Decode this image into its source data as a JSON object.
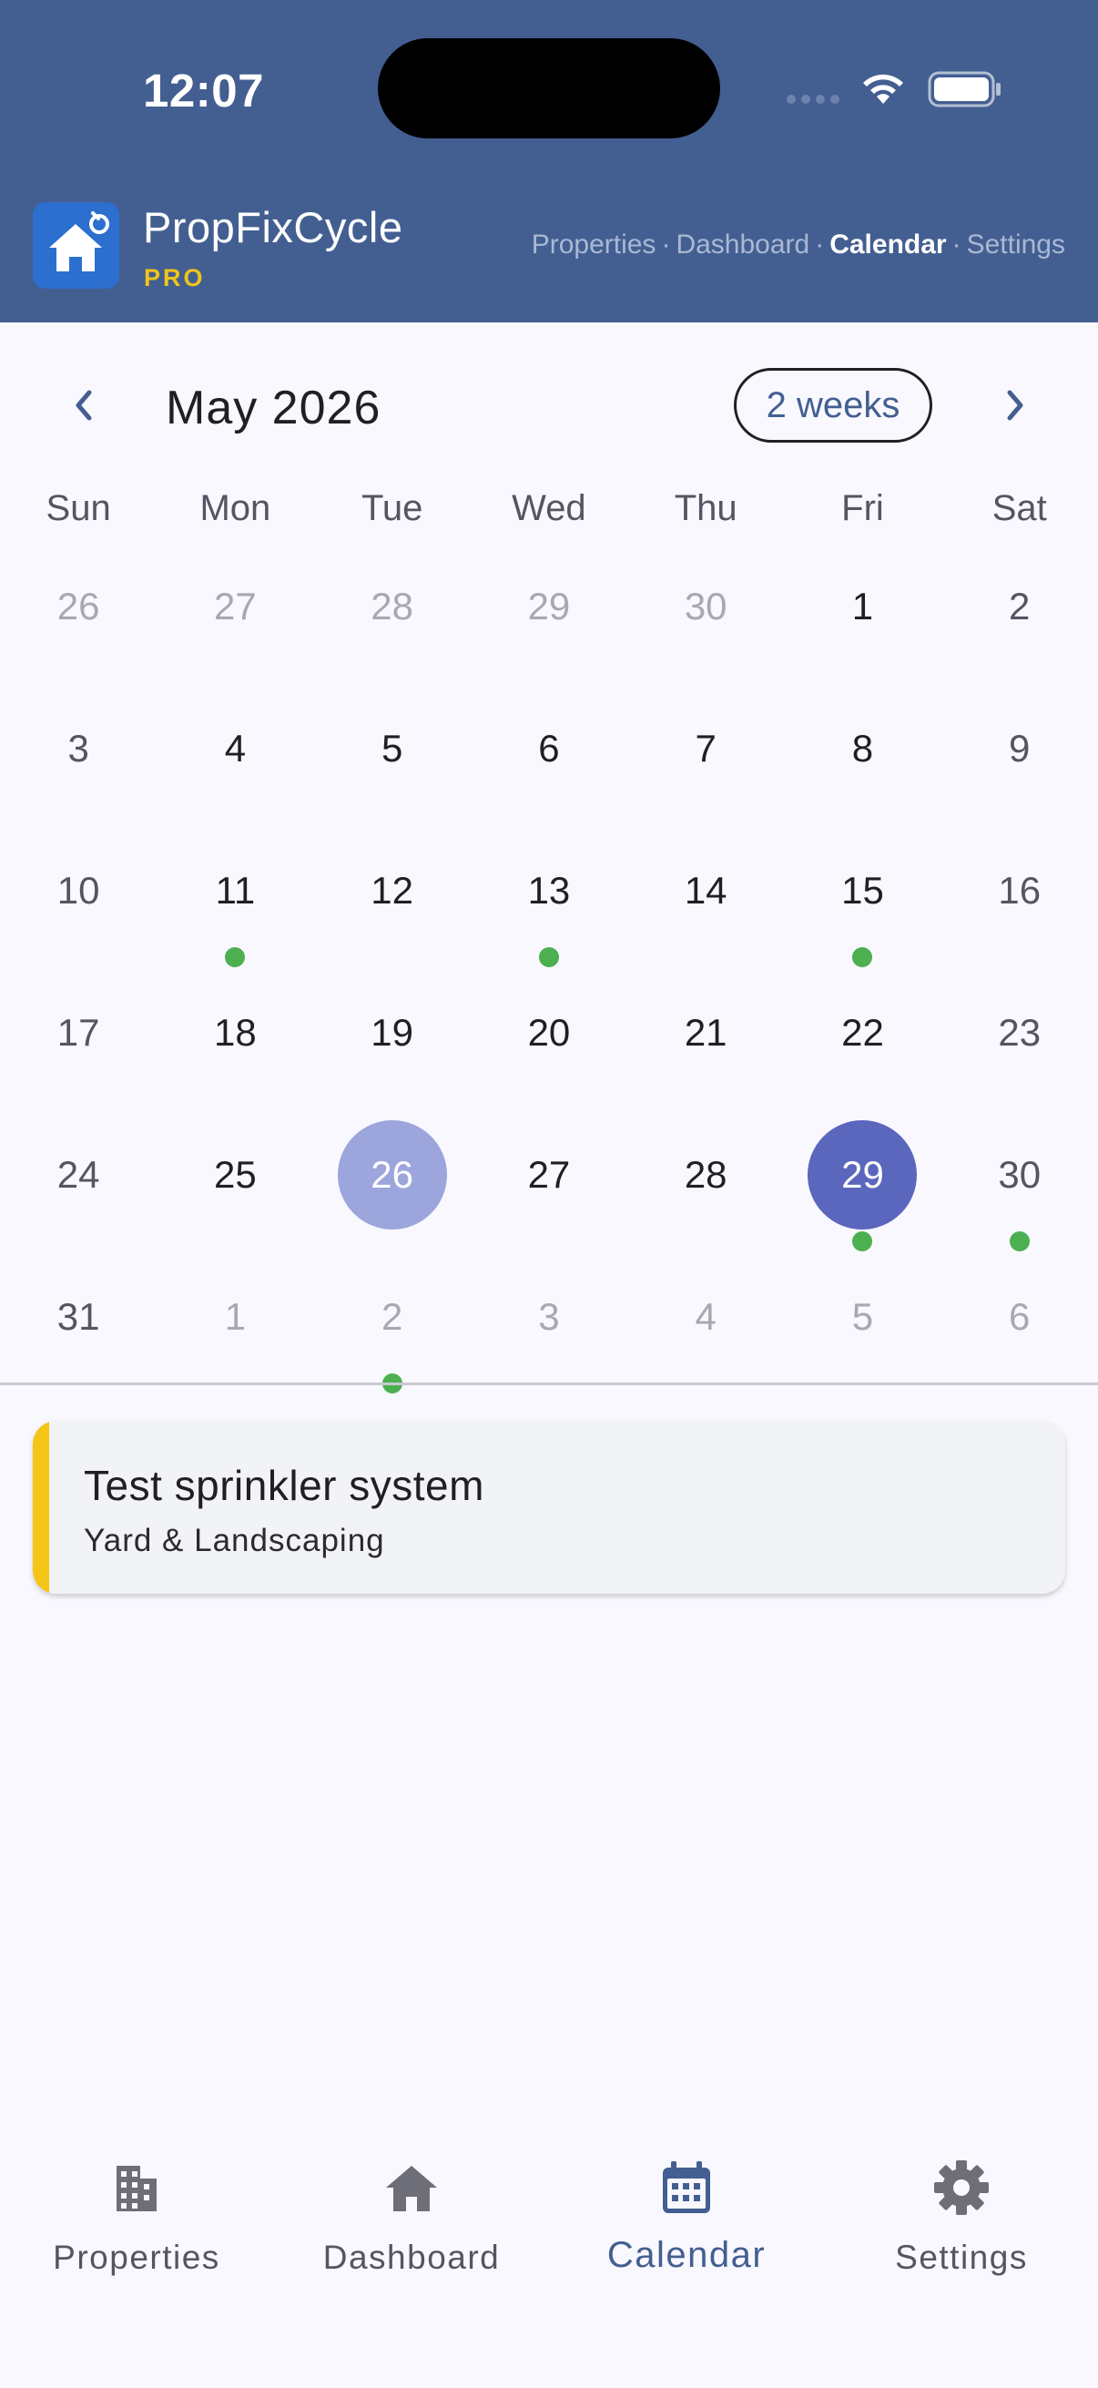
{
  "status_bar": {
    "time": "12:07"
  },
  "app": {
    "title": "PropFixCycle",
    "tier": "PRO"
  },
  "top_nav": {
    "items": [
      {
        "label": "Properties",
        "active": false
      },
      {
        "label": "Dashboard",
        "active": false
      },
      {
        "label": "Calendar",
        "active": true
      },
      {
        "label": "Settings",
        "active": false
      }
    ],
    "separator": "·"
  },
  "calendar": {
    "month_title": "May 2026",
    "range_button": "2 weeks",
    "weekdays": [
      "Sun",
      "Mon",
      "Tue",
      "Wed",
      "Thu",
      "Fri",
      "Sat"
    ],
    "today": 26,
    "selected": 29,
    "weeks": [
      [
        {
          "day": "26",
          "outside": true
        },
        {
          "day": "27",
          "outside": true
        },
        {
          "day": "28",
          "outside": true
        },
        {
          "day": "29",
          "outside": true
        },
        {
          "day": "30",
          "outside": true
        },
        {
          "day": "1"
        },
        {
          "day": "2"
        }
      ],
      [
        {
          "day": "3"
        },
        {
          "day": "4"
        },
        {
          "day": "5"
        },
        {
          "day": "6"
        },
        {
          "day": "7"
        },
        {
          "day": "8"
        },
        {
          "day": "9"
        }
      ],
      [
        {
          "day": "10"
        },
        {
          "day": "11",
          "event": true
        },
        {
          "day": "12"
        },
        {
          "day": "13",
          "event": true
        },
        {
          "day": "14"
        },
        {
          "day": "15",
          "event": true
        },
        {
          "day": "16"
        }
      ],
      [
        {
          "day": "17"
        },
        {
          "day": "18"
        },
        {
          "day": "19"
        },
        {
          "day": "20"
        },
        {
          "day": "21"
        },
        {
          "day": "22"
        },
        {
          "day": "23"
        }
      ],
      [
        {
          "day": "24"
        },
        {
          "day": "25"
        },
        {
          "day": "26",
          "today": true
        },
        {
          "day": "27"
        },
        {
          "day": "28"
        },
        {
          "day": "29",
          "selected": true,
          "event": true
        },
        {
          "day": "30",
          "event": true
        }
      ],
      [
        {
          "day": "31"
        },
        {
          "day": "1",
          "outside": true
        },
        {
          "day": "2",
          "outside": true,
          "event": true
        },
        {
          "day": "3",
          "outside": true
        },
        {
          "day": "4",
          "outside": true
        },
        {
          "day": "5",
          "outside": true
        },
        {
          "day": "6",
          "outside": true
        }
      ]
    ]
  },
  "events": [
    {
      "title": "Test sprinkler system",
      "category": "Yard & Landscaping",
      "accent_color": "#f5c518"
    }
  ],
  "bottom_nav": {
    "items": [
      {
        "label": "Properties",
        "icon": "building-icon",
        "active": false
      },
      {
        "label": "Dashboard",
        "icon": "home-icon",
        "active": false
      },
      {
        "label": "Calendar",
        "icon": "calendar-icon",
        "active": true
      },
      {
        "label": "Settings",
        "icon": "gear-icon",
        "active": false
      }
    ]
  },
  "colors": {
    "header": "#435f91",
    "today_highlight": "#9ca6dc",
    "selected_highlight": "#5b66bd",
    "event_dot": "#4caf50",
    "pro_badge": "#f0c419"
  }
}
